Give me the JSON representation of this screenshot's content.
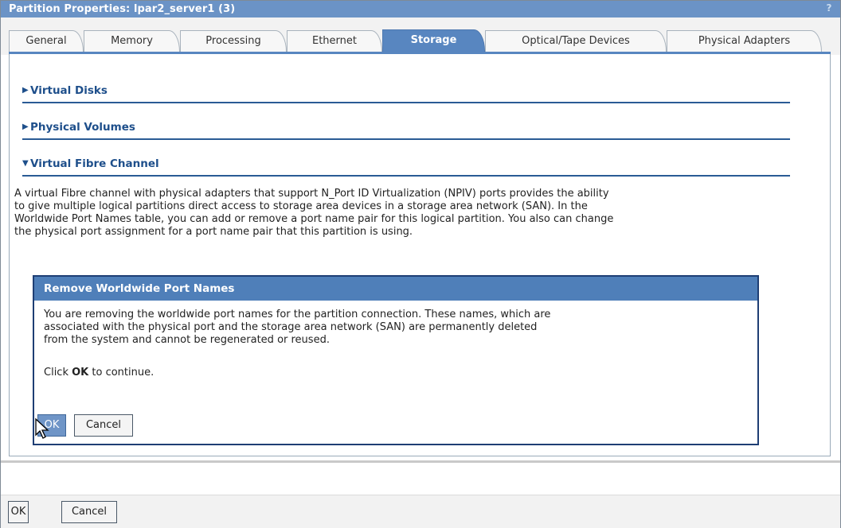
{
  "window": {
    "title": "Partition Properties: lpar2_server1 (3)",
    "help_glyph": "?"
  },
  "tabs": [
    {
      "label": "General",
      "active": false
    },
    {
      "label": "Memory",
      "active": false
    },
    {
      "label": "Processing",
      "active": false
    },
    {
      "label": "Ethernet",
      "active": false
    },
    {
      "label": "Storage",
      "active": true
    },
    {
      "label": "Optical/Tape Devices",
      "active": false
    },
    {
      "label": "Physical Adapters",
      "active": false
    }
  ],
  "sections": {
    "virtual_disks": {
      "label": "Virtual Disks",
      "expanded": false
    },
    "physical_volumes": {
      "label": "Physical Volumes",
      "expanded": false
    },
    "virtual_fibre_channel": {
      "label": "Virtual Fibre Channel",
      "expanded": true
    }
  },
  "description": {
    "line1": "A virtual Fibre channel with physical adapters that support N_Port ID Virtualization (NPIV) ports provides the ability",
    "line2": "to give multiple logical partitions direct access to storage area devices in a storage area network (SAN). In the",
    "line3": "Worldwide Port Names table, you can add or remove a port name pair for this logical partition. You also can change",
    "line4": "the physical port assignment for a port name pair that this partition is using."
  },
  "dialog": {
    "title": "Remove Worldwide Port Names",
    "message_line1": "You are removing the worldwide port names for the partition connection. These names, which are",
    "message_line2": "associated with the physical port and the storage area network (SAN) are permanently deleted",
    "message_line3": "from the system and cannot be regenerated or reused.",
    "instruction_prefix": "Click",
    "instruction_bold": "OK",
    "instruction_suffix": "to continue.",
    "ok_label": "OK",
    "cancel_label": "Cancel"
  },
  "footer": {
    "ok_label": "OK",
    "cancel_label": "Cancel"
  },
  "colors": {
    "titlebar": "#6b93c6",
    "active_tab": "#5886c0",
    "section_rule": "#2a5b95",
    "dialog_header": "#4f7fb9",
    "dialog_border": "#1e3e74"
  }
}
